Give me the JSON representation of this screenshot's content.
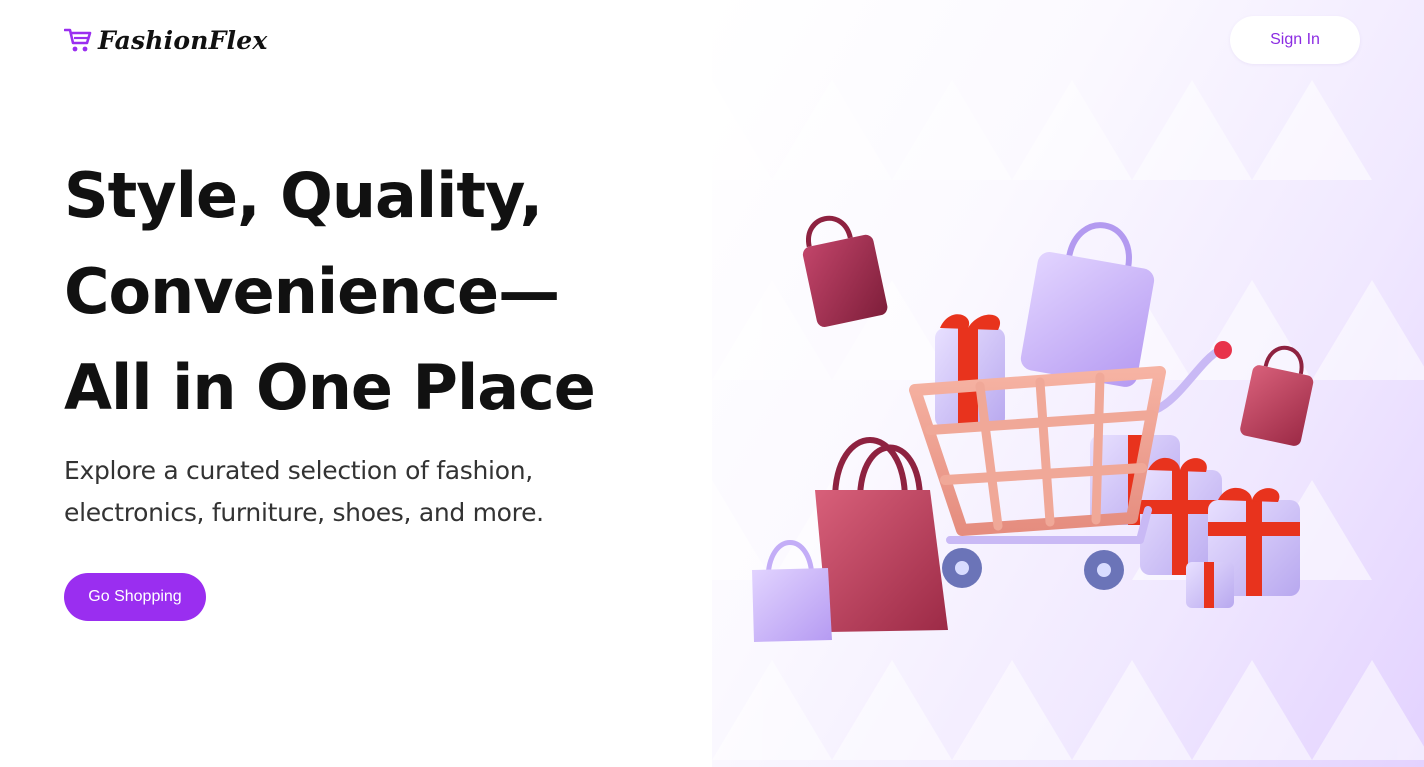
{
  "brand": {
    "name": "FashionFlex",
    "icon": "shopping-cart-icon",
    "accent": "#9a2ef0"
  },
  "header": {
    "sign_in_label": "Sign In"
  },
  "hero": {
    "headline_lines": [
      "Style, Quality,",
      "Convenience—",
      "All in One Place"
    ],
    "description_lines": [
      "Explore a curated selection of fashion,",
      "electronics, furniture, shoes, and more."
    ],
    "cta_label": "Go Shopping",
    "illustration": "shopping-cart-with-bags-and-gifts-illustration"
  },
  "colors": {
    "text": "#111111",
    "cta_background": "#9a2ef0",
    "cta_text": "#ffffff",
    "sign_in_text": "#8b2be2",
    "panel_gradient_end": "#e3d2ff"
  }
}
